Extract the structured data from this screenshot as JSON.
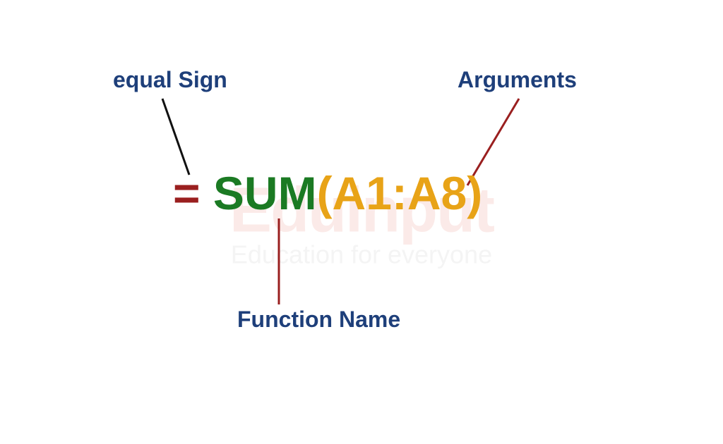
{
  "labels": {
    "equal_sign": "equal Sign",
    "arguments": "Arguments",
    "function_name": "Function Name"
  },
  "formula": {
    "equals": "=",
    "space": " ",
    "function": "SUM",
    "open_paren": "(",
    "arguments": "A1:A8",
    "close_paren": ")"
  },
  "watermark": {
    "main": "Eduinput",
    "sub": "Education for everyone"
  }
}
